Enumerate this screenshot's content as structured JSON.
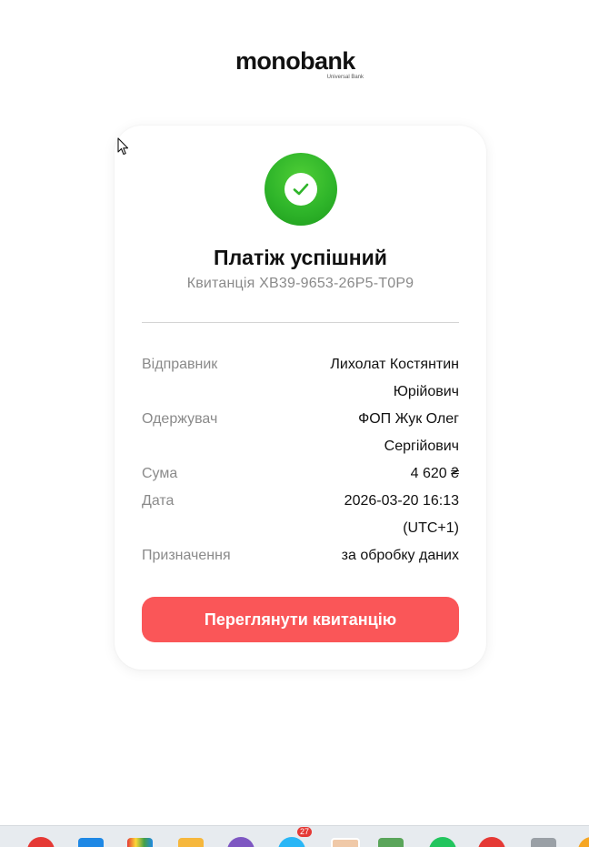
{
  "logo": {
    "wordmark": "monobank",
    "subtitle": "Universal Bank"
  },
  "status": {
    "title": "Платіж успішний",
    "receipt": "Квитанція XB39-9653-26P5-T0P9",
    "icon": "check-circle-icon",
    "color": "#2fb52a"
  },
  "details": [
    {
      "label": "Відправник",
      "value": "Лихолат Костянтин Юрійович"
    },
    {
      "label": "Одержувач",
      "value": "ФОП Жук Олег Сергійович"
    },
    {
      "label": "Сума",
      "value": "4 620 ₴"
    },
    {
      "label": "Дата",
      "value": "2026-03-20 16:13 (UTC+1)"
    },
    {
      "label": "Призначення",
      "value": "за обробку даних"
    }
  ],
  "button": {
    "label": "Переглянути квитанцію",
    "color": "#fa5658"
  },
  "taskbar": {
    "badge": "27"
  }
}
